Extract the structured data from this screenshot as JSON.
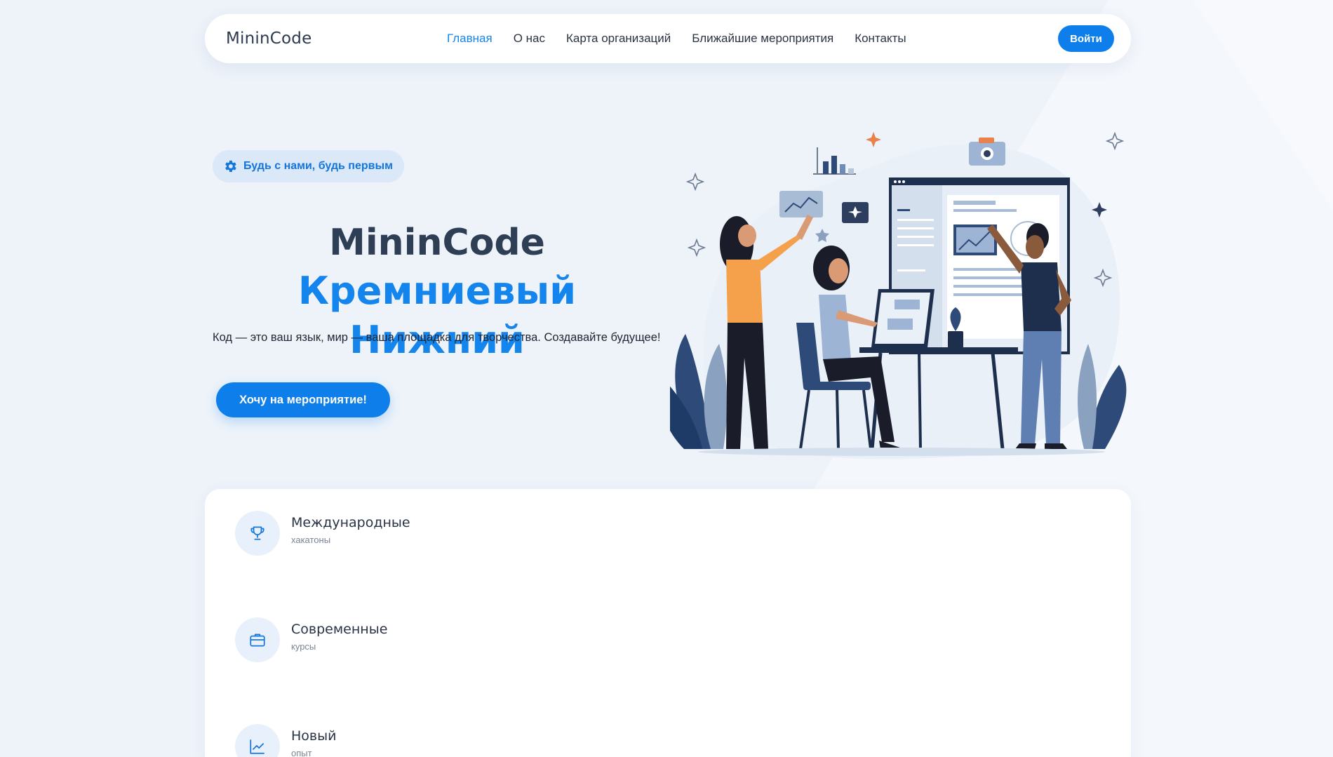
{
  "header": {
    "brand": "MininCode",
    "nav": [
      {
        "label": "Главная",
        "active": true
      },
      {
        "label": "О нас",
        "active": false
      },
      {
        "label": "Карта организаций",
        "active": false
      },
      {
        "label": "Ближайшие мероприятия",
        "active": false
      },
      {
        "label": "Контакты",
        "active": false
      }
    ],
    "login_label": "Войти"
  },
  "hero": {
    "badge_icon": "gear-icon",
    "badge_text": "Будь с нами, будь первым",
    "title_line1": "MininCode",
    "title_line2": "Кремниевый Нижний",
    "subtitle": "Код — это ваш язык, мир — ваша площадка для творчества. Создавайте будущее!",
    "cta_label": "Хочу на мероприятие!",
    "illustration": "team-working-illustration"
  },
  "features": [
    {
      "icon": "trophy-icon",
      "title": "Международные",
      "subtitle": "хакатоны"
    },
    {
      "icon": "briefcase-icon",
      "title": "Современные",
      "subtitle": "курсы"
    },
    {
      "icon": "chart-line-icon",
      "title": "Новый",
      "subtitle": "опыт"
    }
  ],
  "colors": {
    "accent": "#0d7eea",
    "accent_text": "#1585ee",
    "page_bg": "#eef3fa",
    "heading": "#2d3e55"
  }
}
